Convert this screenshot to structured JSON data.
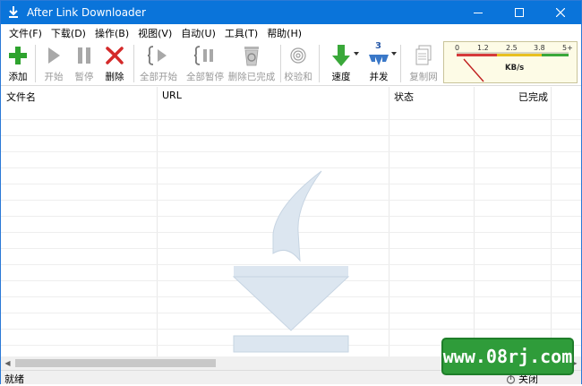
{
  "window": {
    "title": "After Link Downloader"
  },
  "menu": [
    "文件(F)",
    "下载(D)",
    "操作(B)",
    "视图(V)",
    "自动(U)",
    "工具(T)",
    "帮助(H)"
  ],
  "toolbar": {
    "add": "添加",
    "start": "开始",
    "pause": "暂停",
    "delete": "删除",
    "start_all": "全部开始",
    "pause_all": "全部暂停",
    "delete_completed": "删除已完成",
    "checksum": "校验和",
    "speed": "速度",
    "concurrent": "并发",
    "concurrent_count": "3",
    "copy": "复制网"
  },
  "meter": {
    "ticks": [
      "0",
      "1.2",
      "2.5",
      "3.8",
      "5+"
    ],
    "unit": "KB/s"
  },
  "table": {
    "columns": [
      "文件名",
      "URL",
      "状态",
      "已完成"
    ]
  },
  "status": {
    "text": "就绪",
    "close": "关闭"
  },
  "badge": {
    "text": "www.08rj.com"
  },
  "icons": [
    "app-icon",
    "minimize-icon",
    "maximize-icon",
    "close-icon",
    "add-icon",
    "play-icon",
    "pause-icon",
    "delete-icon",
    "start-all-icon",
    "pause-all-icon",
    "recycle-icon",
    "fingerprint-icon",
    "download-arrow-icon",
    "concurrent-icon",
    "copy-icon"
  ]
}
